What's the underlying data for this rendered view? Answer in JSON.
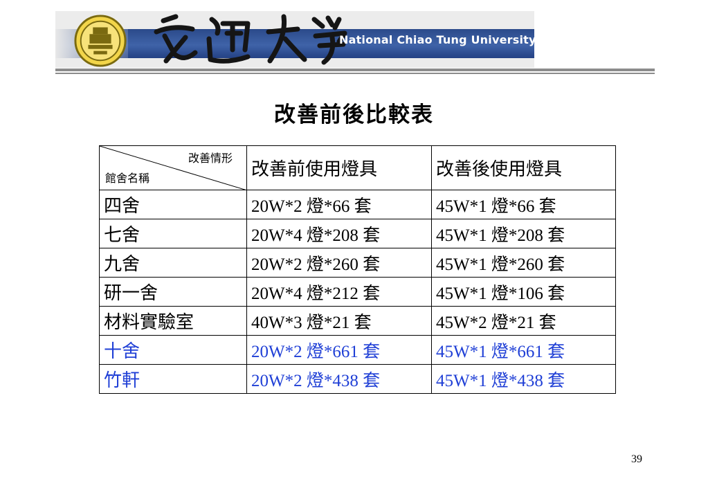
{
  "banner": {
    "english_name": "National Chiao Tung University",
    "chinese_name": "交通大學"
  },
  "title": "改善前後比較表",
  "table": {
    "corner_top": "改善情形",
    "corner_bottom": "館舍名稱",
    "col_before": "改善前使用燈具",
    "col_after": "改善後使用燈具",
    "rows": [
      {
        "name": "四舍",
        "before": "20W*2 燈*66 套",
        "after": "45W*1 燈*66 套"
      },
      {
        "name": "七舍",
        "before": "20W*4 燈*208 套",
        "after": "45W*1 燈*208 套"
      },
      {
        "name": "九舍",
        "before": "20W*2 燈*260 套",
        "after": "45W*1 燈*260 套"
      },
      {
        "name": "研一舍",
        "before": "20W*4 燈*212 套",
        "after": "45W*1 燈*106 套"
      },
      {
        "name": "材料實驗室",
        "before": "40W*3 燈*21 套",
        "after": "45W*2 燈*21 套"
      },
      {
        "name": "十舍",
        "before": "20W*2 燈*661 套",
        "after": "45W*1 燈*661 套"
      },
      {
        "name": "竹軒",
        "before": "20W*2 燈*438 套",
        "after": "45W*1 燈*438 套"
      }
    ]
  },
  "highlight_color": "#1f3fd6",
  "page_number": "39"
}
